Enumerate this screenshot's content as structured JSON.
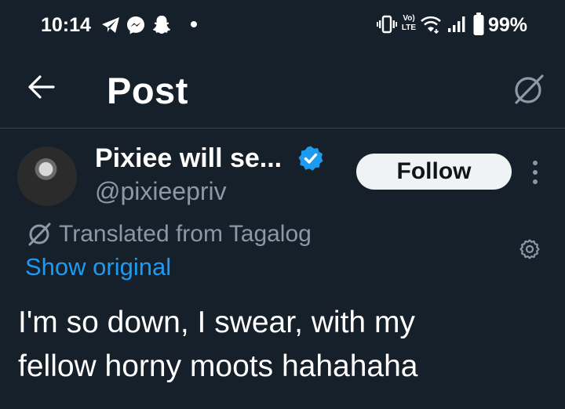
{
  "status_bar": {
    "time": "10:14",
    "battery": "99%",
    "left_icons": [
      "telegram-icon",
      "messenger-icon",
      "snapchat-icon",
      "dot-icon"
    ],
    "right_icons": [
      "vibrate-icon",
      "volte-icon",
      "wifi-icon",
      "signal-icon",
      "battery-icon"
    ],
    "volte_top": "Vo)",
    "volte_bottom": "LTE"
  },
  "header": {
    "title": "Post",
    "back_icon": "back-arrow-icon",
    "action_icon": "translate-icon"
  },
  "author": {
    "display_name": "Pixiee will se...",
    "handle": "@pixieepriv",
    "verified": true,
    "follow_label": "Follow"
  },
  "translation": {
    "label": "Translated from Tagalog",
    "show_original": "Show original"
  },
  "post": {
    "line1": "I'm so down, I swear, with my",
    "line2": "fellow horny moots hahahaha"
  },
  "colors": {
    "background": "#15202b",
    "accent": "#1d9bf0",
    "secondary_text": "#8b98a5",
    "follow_bg": "#eff3f4"
  }
}
